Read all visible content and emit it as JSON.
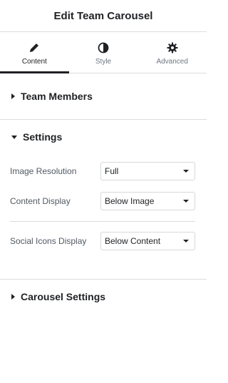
{
  "header": {
    "title": "Edit Team Carousel"
  },
  "tabs": [
    {
      "label": "Content",
      "icon": "pencil-icon",
      "active": true
    },
    {
      "label": "Style",
      "icon": "contrast-icon",
      "active": false
    },
    {
      "label": "Advanced",
      "icon": "gear-icon",
      "active": false
    }
  ],
  "sections": {
    "team_members": {
      "label": "Team Members",
      "expanded": false
    },
    "settings": {
      "label": "Settings",
      "expanded": true,
      "fields": [
        {
          "label": "Image Resolution",
          "value": "Full"
        },
        {
          "label": "Content Display",
          "value": "Below Image"
        },
        {
          "label": "Social Icons Display",
          "value": "Below Content"
        }
      ]
    },
    "carousel_settings": {
      "label": "Carousel Settings",
      "expanded": false
    }
  }
}
